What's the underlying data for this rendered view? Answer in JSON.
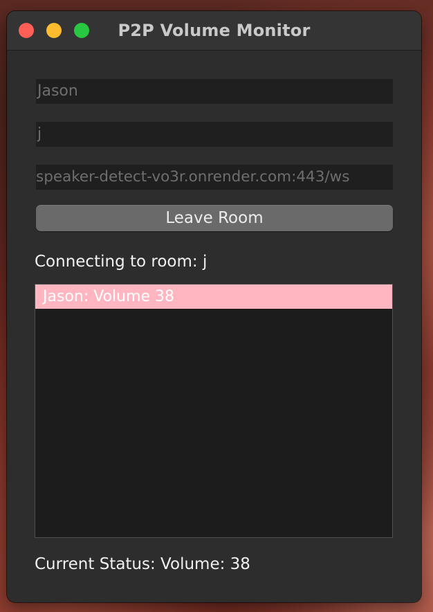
{
  "window": {
    "title": "P2P Volume Monitor"
  },
  "form": {
    "name_value": "Jason",
    "room_value": "j",
    "server_value": "speaker-detect-vo3r.onrender.com:443/ws",
    "leave_button_label": "Leave Room"
  },
  "connection": {
    "status_text": "Connecting to room: j"
  },
  "participants": [
    {
      "label": "Jason: Volume 38",
      "highlight_color": "#ffb6c1"
    }
  ],
  "footer": {
    "current_status": "Current Status: Volume: 38"
  },
  "colors": {
    "window_bg": "#2d2d2d",
    "field_bg": "#1f1f1f",
    "list_bg": "#1c1c1c",
    "button_bg": "#6a6a6a",
    "close": "#ff5f57",
    "minimize": "#febc2e",
    "zoom": "#28c840"
  }
}
